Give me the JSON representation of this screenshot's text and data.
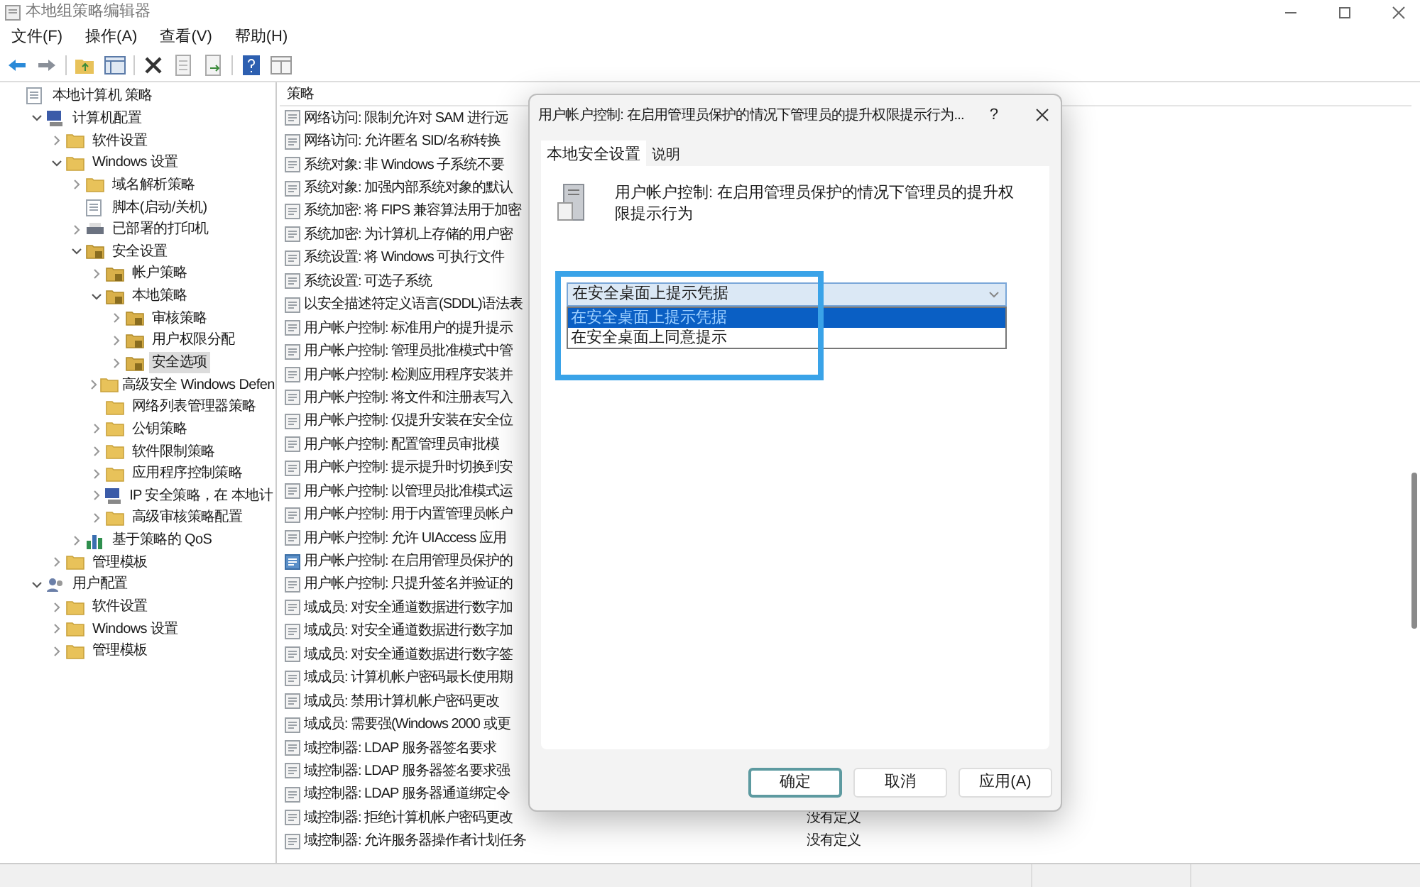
{
  "window": {
    "title": "本地组策略编辑器"
  },
  "menu": [
    "文件(F)",
    "操作(A)",
    "查看(V)",
    "帮助(H)"
  ],
  "tree": [
    {
      "label": "本地计算机 策略",
      "kind": "doc",
      "children": [
        {
          "label": "计算机配置",
          "kind": "computer",
          "expanded": true,
          "children": [
            {
              "label": "软件设置",
              "kind": "folder",
              "expanded": false
            },
            {
              "label": "Windows 设置",
              "kind": "folder",
              "expanded": true,
              "children": [
                {
                  "label": "域名解析策略",
                  "kind": "folder",
                  "expanded": false
                },
                {
                  "label": "脚本(启动/关机)",
                  "kind": "doc"
                },
                {
                  "label": "已部署的打印机",
                  "kind": "printer",
                  "expanded": false
                },
                {
                  "label": "安全设置",
                  "kind": "secure",
                  "expanded": true,
                  "children": [
                    {
                      "label": "帐户策略",
                      "kind": "secure",
                      "expanded": false
                    },
                    {
                      "label": "本地策略",
                      "kind": "secure",
                      "expanded": true,
                      "children": [
                        {
                          "label": "审核策略",
                          "kind": "secure",
                          "expanded": false,
                          "selected": false
                        },
                        {
                          "label": "用户权限分配",
                          "kind": "secure",
                          "expanded": false,
                          "selected": false
                        },
                        {
                          "label": "安全选项",
                          "kind": "secure",
                          "expanded": false,
                          "selected": true
                        }
                      ]
                    },
                    {
                      "label": "高级安全 Windows Defen",
                      "kind": "folder",
                      "expanded": false
                    },
                    {
                      "label": "网络列表管理器策略",
                      "kind": "folder"
                    },
                    {
                      "label": "公钥策略",
                      "kind": "folder",
                      "expanded": false
                    },
                    {
                      "label": "软件限制策略",
                      "kind": "folder",
                      "expanded": false
                    },
                    {
                      "label": "应用程序控制策略",
                      "kind": "folder",
                      "expanded": false
                    },
                    {
                      "label": "IP 安全策略，在 本地计",
                      "kind": "computer",
                      "expanded": false
                    },
                    {
                      "label": "高级审核策略配置",
                      "kind": "folder",
                      "expanded": false
                    }
                  ]
                },
                {
                  "label": "基于策略的 QoS",
                  "kind": "chart",
                  "expanded": false
                }
              ]
            },
            {
              "label": "管理模板",
              "kind": "folder",
              "expanded": false
            }
          ]
        },
        {
          "label": "用户配置",
          "kind": "user",
          "expanded": true,
          "children": [
            {
              "label": "软件设置",
              "kind": "folder",
              "expanded": false
            },
            {
              "label": "Windows 设置",
              "kind": "folder",
              "expanded": false
            },
            {
              "label": "管理模板",
              "kind": "folder",
              "expanded": false
            }
          ]
        }
      ]
    }
  ],
  "list": {
    "columns": [
      "策略"
    ],
    "rows": [
      {
        "policy": "网络访问: 限制允许对 SAM 进行远",
        "selected": false
      },
      {
        "policy": "网络访问: 允许匿名 SID/名称转换",
        "selected": false
      },
      {
        "policy": "系统对象: 非 Windows 子系统不要",
        "selected": false
      },
      {
        "policy": "系统对象: 加强内部系统对象的默认",
        "selected": false
      },
      {
        "policy": "系统加密: 将 FIPS 兼容算法用于加密",
        "selected": false
      },
      {
        "policy": "系统加密: 为计算机上存储的用户密",
        "selected": false
      },
      {
        "policy": "系统设置: 将 Windows 可执行文件",
        "selected": false
      },
      {
        "policy": "系统设置: 可选子系统",
        "selected": false
      },
      {
        "policy": "以安全描述符定义语言(SDDL)语法表",
        "selected": false
      },
      {
        "policy": "用户帐户控制: 标准用户的提升提示",
        "selected": false
      },
      {
        "policy": "用户帐户控制: 管理员批准模式中管",
        "selected": false
      },
      {
        "policy": "用户帐户控制: 检测应用程序安装并",
        "selected": false
      },
      {
        "policy": "用户帐户控制: 将文件和注册表写入",
        "selected": false
      },
      {
        "policy": "用户帐户控制: 仅提升安装在安全位",
        "selected": false
      },
      {
        "policy": "用户帐户控制:   配置管理员审批模",
        "selected": false
      },
      {
        "policy": "用户帐户控制: 提示提升时切换到安",
        "selected": false
      },
      {
        "policy": "用户帐户控制: 以管理员批准模式运",
        "selected": false
      },
      {
        "policy": "用户帐户控制: 用于内置管理员帐户",
        "selected": false
      },
      {
        "policy": "用户帐户控制: 允许 UIAccess 应用",
        "selected": false
      },
      {
        "policy": "用户帐户控制: 在启用管理员保护的",
        "selected": true
      },
      {
        "policy": "用户帐户控制: 只提升签名并验证的",
        "selected": false
      },
      {
        "policy": "域成员: 对安全通道数据进行数字加",
        "selected": false
      },
      {
        "policy": "域成员: 对安全通道数据进行数字加",
        "selected": false
      },
      {
        "policy": "域成员: 对安全通道数据进行数字签",
        "selected": false
      },
      {
        "policy": "域成员: 计算机帐户密码最长使用期",
        "selected": false
      },
      {
        "policy": "域成员: 禁用计算机帐户密码更改",
        "selected": false
      },
      {
        "policy": "域成员: 需要强(Windows 2000 或更",
        "selected": false
      },
      {
        "policy": "域控制器: LDAP 服务器签名要求",
        "selected": false
      },
      {
        "policy": "域控制器: LDAP 服务器签名要求强",
        "selected": false
      },
      {
        "policy": "域控制器: LDAP 服务器通道绑定令",
        "selected": false
      },
      {
        "policy": "域控制器: 拒绝计算机帐户密码更改",
        "setting": "没有定义",
        "selected": false
      },
      {
        "policy": "域控制器: 允许服务器操作者计划任务",
        "setting": "没有定义",
        "selected": false
      }
    ]
  },
  "dialog": {
    "title": "用户帐户控制: 在启用管理员保护的情况下管理员的提升权限提示行为...",
    "help": "?",
    "tabs": [
      {
        "label": "本地安全设置",
        "selected": true
      },
      {
        "label": "说明",
        "selected": false
      }
    ],
    "description": "用户帐户控制: 在启用管理员保护的情况下管理员的提升权限提示行为",
    "dropdown": {
      "value": "在安全桌面上提示凭据",
      "expanded": true,
      "options": [
        {
          "label": "在安全桌面上提示凭据",
          "selected": true
        },
        {
          "label": "在安全桌面上同意提示",
          "selected": false
        }
      ]
    },
    "buttons": [
      {
        "label": "确定",
        "default": true
      },
      {
        "label": "取消",
        "default": false
      },
      {
        "label": "应用(A)",
        "default": false
      }
    ]
  }
}
